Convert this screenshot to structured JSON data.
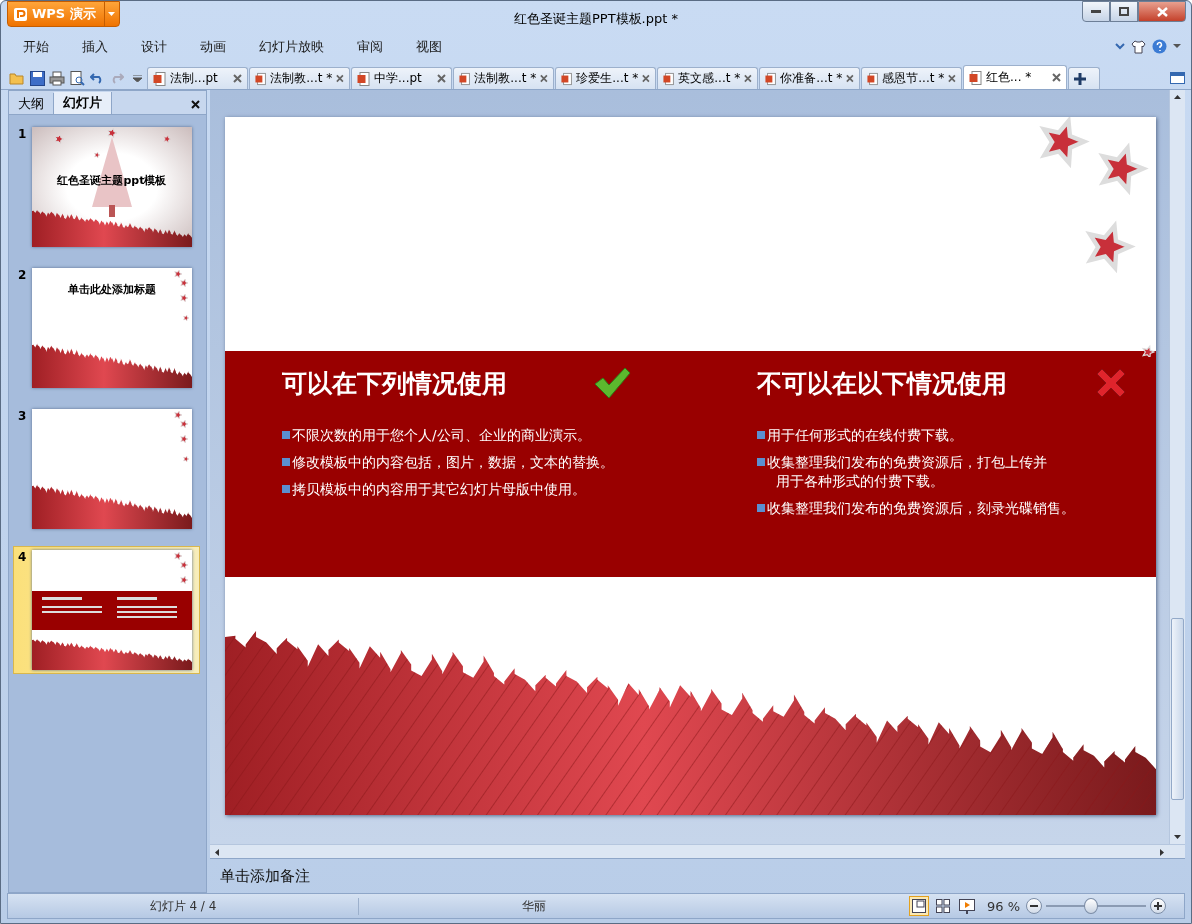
{
  "app": {
    "name": "WPS 演示"
  },
  "window": {
    "title": "红色圣诞主题PPT模板.ppt *"
  },
  "menu": [
    "开始",
    "插入",
    "设计",
    "动画",
    "幻灯片放映",
    "审阅",
    "视图"
  ],
  "doc_tabs": [
    {
      "label": "法制...pt",
      "selected": false
    },
    {
      "label": "法制教...t *",
      "selected": false
    },
    {
      "label": "中学...pt",
      "selected": false
    },
    {
      "label": "法制教...t *",
      "selected": false
    },
    {
      "label": "珍爱生...t *",
      "selected": false
    },
    {
      "label": "英文感...t *",
      "selected": false
    },
    {
      "label": "你准备...t *",
      "selected": false
    },
    {
      "label": "感恩节...t *",
      "selected": false
    },
    {
      "label": "红色... *",
      "selected": true
    }
  ],
  "panel_tabs": [
    {
      "label": "大纲",
      "selected": false
    },
    {
      "label": "幻灯片",
      "selected": true
    }
  ],
  "thumbnails": [
    {
      "number": "1",
      "kind": "title",
      "title": "红色圣诞主题ppt模板",
      "selected": false
    },
    {
      "number": "2",
      "kind": "content",
      "title": "单击此处添加标题",
      "selected": false
    },
    {
      "number": "3",
      "kind": "blank",
      "selected": false
    },
    {
      "number": "4",
      "kind": "band",
      "selected": true
    }
  ],
  "slide": {
    "columns": [
      {
        "kind": "allowed",
        "heading": "可以在下列情况使用",
        "items": [
          {
            "lines": [
              "不限次数的用于您个人/公司、企业的商业演示。"
            ]
          },
          {
            "lines": [
              "修改模板中的内容包括，图片，数据，文本的替换。"
            ]
          },
          {
            "lines": [
              "拷贝模板中的内容用于其它幻灯片母版中使用。"
            ]
          }
        ]
      },
      {
        "kind": "forbidden",
        "heading": "不可以在以下情况使用",
        "items": [
          {
            "lines": [
              "用于任何形式的在线付费下载。"
            ]
          },
          {
            "lines": [
              "收集整理我们发布的免费资源后，打包上传并",
              "用于各种形式的付费下载。"
            ]
          },
          {
            "lines": [
              "收集整理我们发布的免费资源后，刻录光碟销售。"
            ]
          }
        ]
      }
    ]
  },
  "notes": {
    "placeholder": "单击添加备注"
  },
  "status_bar": {
    "slide_count": "幻灯片 4 / 4",
    "theme": "华丽",
    "zoom": "96 %",
    "zoom_level": {
      "level": 0.45
    },
    "views": [
      {
        "kind": "normal",
        "selected": true
      },
      {
        "kind": "sorter",
        "selected": false
      },
      {
        "kind": "show",
        "selected": false
      }
    ]
  }
}
